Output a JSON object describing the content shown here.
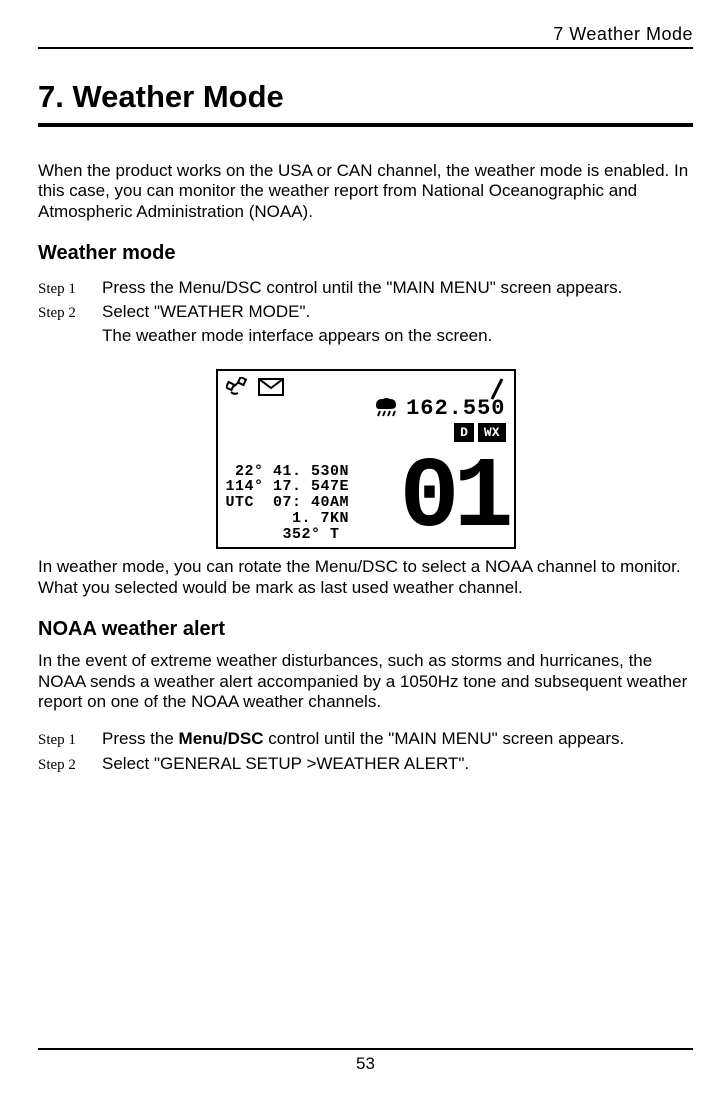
{
  "header": {
    "running": "7  Weather  Mode"
  },
  "title": "7. Weather Mode",
  "intro": "When the product works on the USA or CAN channel, the weather mode is enabled. In this case, you can monitor the weather report from National Oceanographic and Atmospheric Administration (NOAA).",
  "section1": {
    "heading": "Weather mode",
    "steps": [
      {
        "label": "Step 1",
        "text": "Press the Menu/DSC control until the \"MAIN MENU\" screen appears."
      },
      {
        "label": "Step 2",
        "text": "Select \"WEATHER MODE\"."
      }
    ],
    "after_step2": "The weather mode interface appears on the screen.",
    "after_lcd": "In weather mode, you can rotate the Menu/DSC to select a NOAA channel to monitor. What you selected would be mark as last used weather channel."
  },
  "lcd": {
    "freq": "162.550",
    "tag_d": "D",
    "tag_wx": "WX",
    "lat": " 22° 41. 530N",
    "lon": "114° 17. 547E",
    "utc": "UTC  07: 40AM",
    "spd": "       1. 7KN",
    "brg": "      352° T",
    "channel": "01"
  },
  "section2": {
    "heading": "NOAA weather alert",
    "intro": "In the event of extreme weather disturbances, such as storms and hurricanes, the NOAA sends a weather alert accompanied by a 1050Hz tone and subsequent weather report on one of the NOAA weather channels.",
    "steps": [
      {
        "label": "Step 1",
        "text_before": "Press the ",
        "text_bold": "Menu/DSC",
        "text_after": " control until the \"MAIN MENU\" screen appears."
      },
      {
        "label": "Step 2",
        "text": "Select \"GENERAL SETUP >WEATHER ALERT\"."
      }
    ]
  },
  "page_number": "53"
}
